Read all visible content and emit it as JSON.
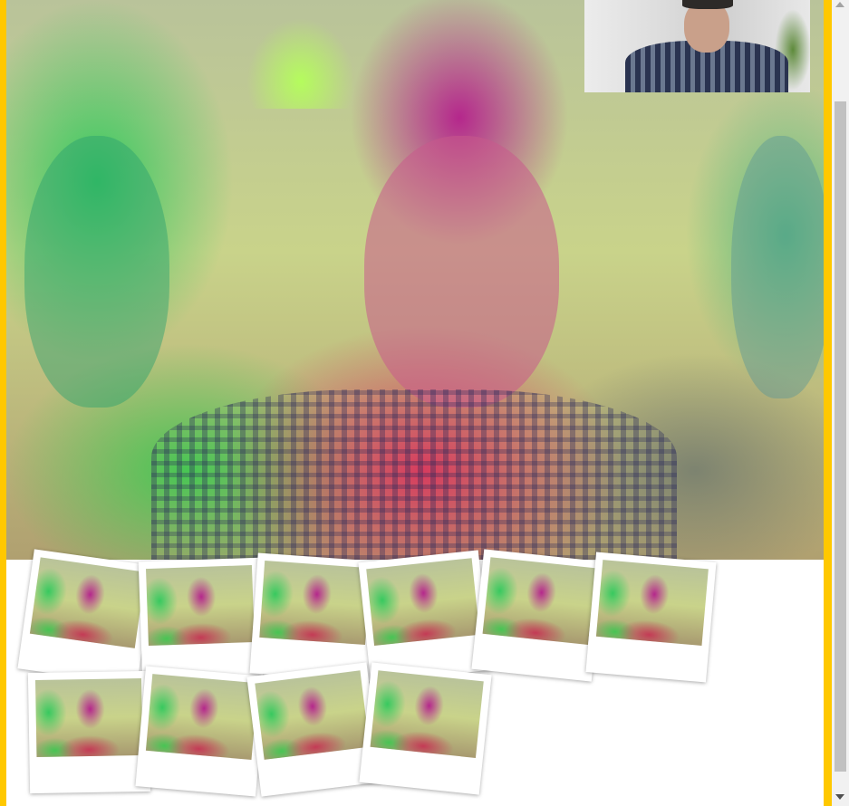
{
  "main_video": {
    "kind": "filtered-webcam-feed"
  },
  "preview": {
    "kind": "raw-webcam-preview"
  },
  "snapshots": [
    {
      "id": 1,
      "rotate": 8
    },
    {
      "id": 2,
      "rotate": -2
    },
    {
      "id": 3,
      "rotate": 4
    },
    {
      "id": 4,
      "rotate": -6
    },
    {
      "id": 5,
      "rotate": 6
    },
    {
      "id": 6,
      "rotate": 5
    },
    {
      "id": 7,
      "rotate": -1
    },
    {
      "id": 8,
      "rotate": 5
    },
    {
      "id": 9,
      "rotate": -7
    },
    {
      "id": 10,
      "rotate": 6
    }
  ],
  "colors": {
    "frame": "#ffc800",
    "background": "#ffffff"
  }
}
